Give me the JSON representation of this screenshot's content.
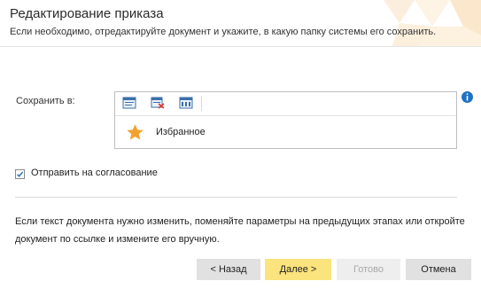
{
  "header": {
    "title": "Редактирование приказа",
    "subtitle": "Если необходимо, отредактируйте документ и укажите, в какую папку системы его сохранить."
  },
  "save_to": {
    "label": "Сохранить в:",
    "toolbar": {
      "icons": [
        "folder-add-icon",
        "folder-remove-icon",
        "folder-rename-icon"
      ]
    },
    "folders": [
      {
        "name": "Избранное",
        "icon": "star-icon"
      }
    ]
  },
  "send_for_approval": {
    "label": "Отправить на согласование",
    "checked": true
  },
  "note": "Если текст документа нужно изменить, поменяйте параметры на предыдущих этапах или откройте документ по ссылке и измените его вручную.",
  "buttons": {
    "back": "< Назад",
    "next": "Далее >",
    "done": "Готово",
    "cancel": "Отмена"
  },
  "colors": {
    "next_button": "#fbe37d",
    "star": "#f2a22c",
    "info": "#1f72c4",
    "header_deco": "#fdf2de"
  }
}
